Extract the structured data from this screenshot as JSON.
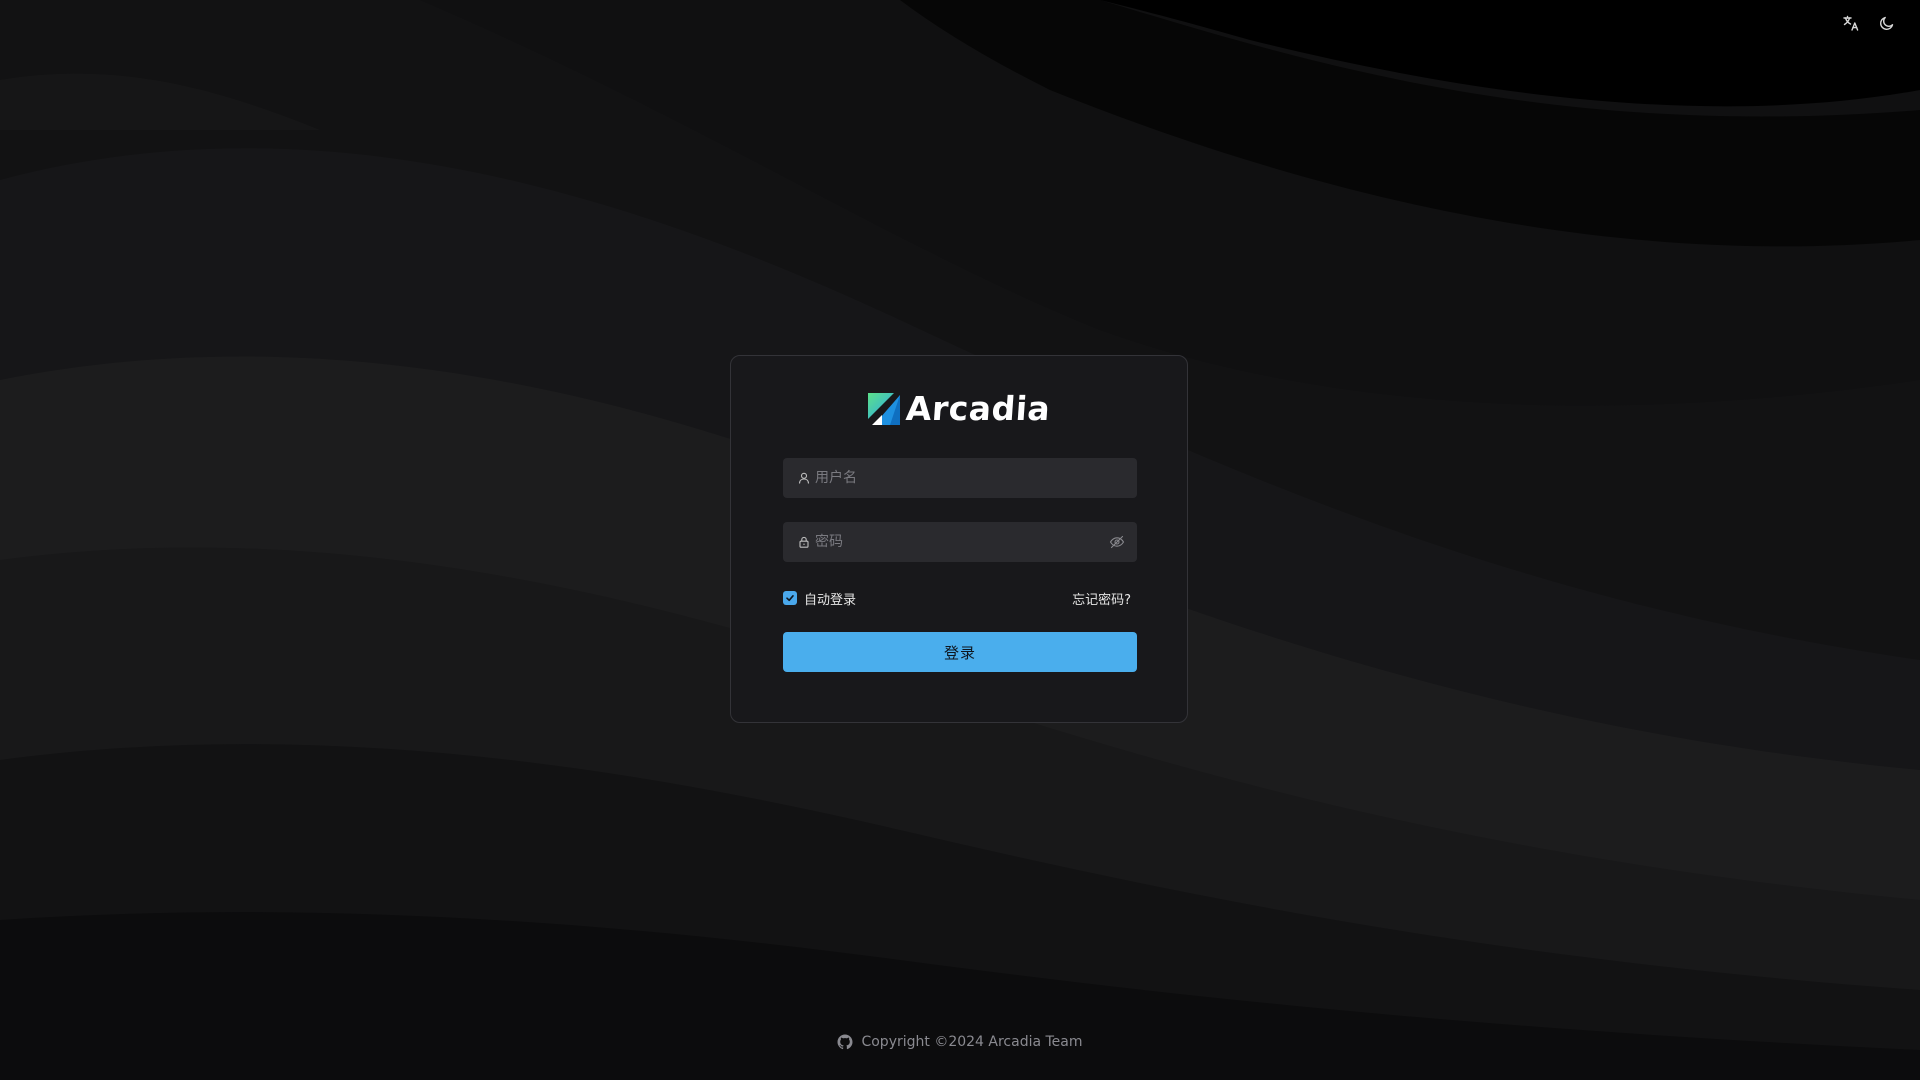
{
  "app": {
    "logo_text": "Arcadia"
  },
  "header": {
    "icons": [
      "translate-icon",
      "moon-icon"
    ]
  },
  "login_form": {
    "username_placeholder": "用户名",
    "username_value": "",
    "password_placeholder": "密码",
    "password_value": "",
    "remember_label": "自动登录",
    "remember_checked": true,
    "forgot_label": "忘记密码?",
    "submit_label": "登录"
  },
  "footer": {
    "copyright": "Copyright ©2024 Arcadia Team"
  },
  "colors": {
    "accent": "#4aaeed",
    "card_bg": "#18181b",
    "input_bg": "#2a2a2e",
    "page_bg": "#0a0a0b"
  }
}
